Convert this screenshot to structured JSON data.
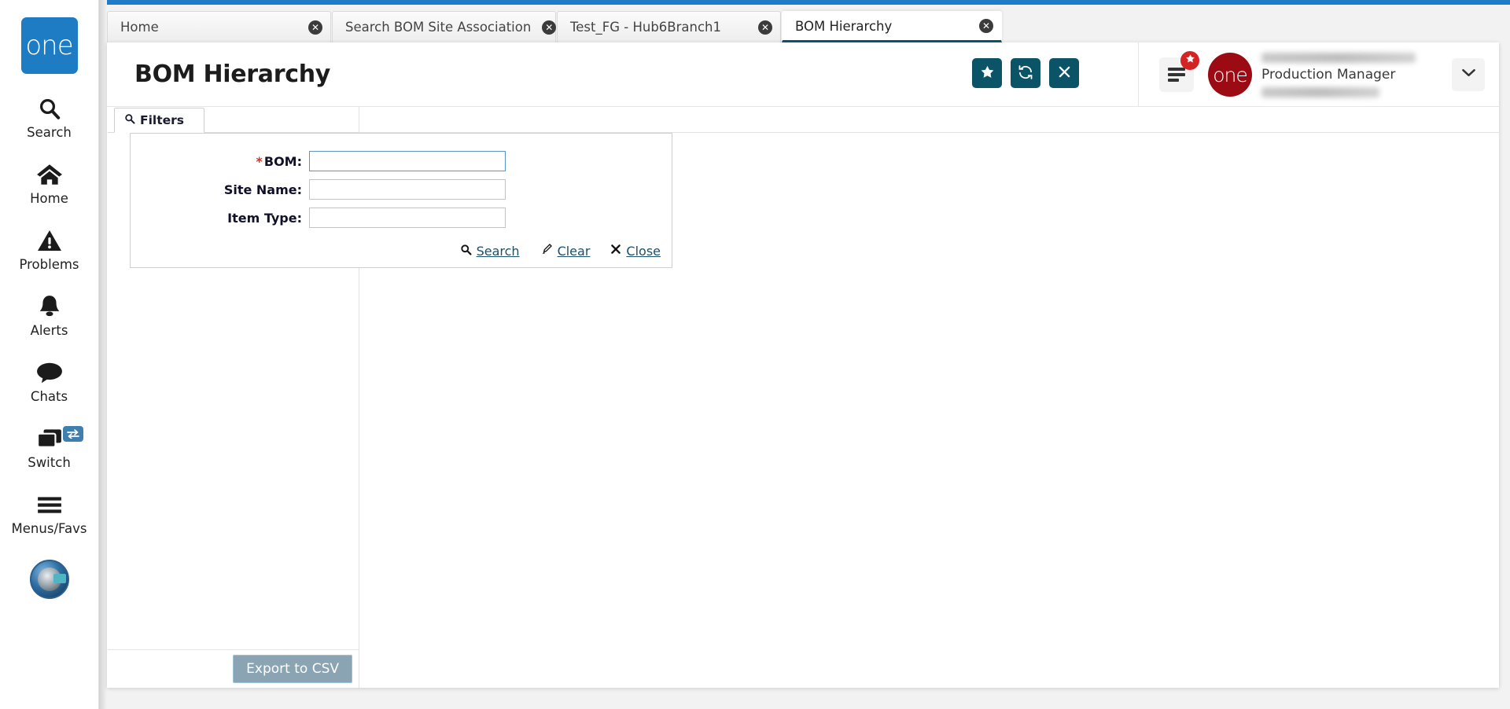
{
  "app": {
    "brand_logo_text": "one",
    "accent_blue": "#1f7bc8",
    "accent_teal": "#0b5366",
    "accent_red": "#9c0a14"
  },
  "sidebar": {
    "items": [
      {
        "label": "Search",
        "icon": "search-icon"
      },
      {
        "label": "Home",
        "icon": "home-icon"
      },
      {
        "label": "Problems",
        "icon": "warning-triangle-icon"
      },
      {
        "label": "Alerts",
        "icon": "bell-icon"
      },
      {
        "label": "Chats",
        "icon": "chat-bubble-icon"
      },
      {
        "label": "Switch",
        "icon": "switch-windows-icon",
        "badge_icon": "exchange-arrows-icon"
      },
      {
        "label": "Menus/Favs",
        "icon": "hamburger-icon"
      }
    ],
    "avatar_icon": "user-avatar-icon"
  },
  "tabs": [
    {
      "label": "Home",
      "active": false,
      "close_icon": "close-circle-icon"
    },
    {
      "label": "Search BOM Site Association",
      "active": false,
      "close_icon": "close-circle-icon"
    },
    {
      "label": "Test_FG - Hub6Branch1",
      "active": false,
      "close_icon": "close-circle-icon"
    },
    {
      "label": "BOM Hierarchy",
      "active": true,
      "close_icon": "close-circle-icon"
    }
  ],
  "header": {
    "title": "BOM Hierarchy",
    "actions": [
      {
        "name": "favorite-button",
        "icon": "star-icon"
      },
      {
        "name": "refresh-button",
        "icon": "refresh-icon"
      },
      {
        "name": "close-page-button",
        "icon": "x-icon"
      }
    ],
    "menu_button": {
      "icon": "hamburger-icon",
      "badge_icon": "star-icon"
    },
    "user": {
      "badge_text": "one",
      "name_redacted": true,
      "role": "Production Manager",
      "org_redacted": true,
      "caret_icon": "chevron-down-icon"
    }
  },
  "left_panel": {
    "tab": {
      "label": "Filters",
      "icon": "search-icon"
    },
    "export_button": "Export to CSV"
  },
  "filters": {
    "fields": [
      {
        "label": "BOM:",
        "required": true,
        "value": "",
        "placeholder": "",
        "focused": true
      },
      {
        "label": "Site Name:",
        "required": false,
        "value": "",
        "placeholder": "",
        "focused": false
      },
      {
        "label": "Item Type:",
        "required": false,
        "value": "",
        "placeholder": "",
        "focused": false
      }
    ],
    "actions": [
      {
        "label": "Search",
        "icon": "search-icon"
      },
      {
        "label": "Clear",
        "icon": "eraser-icon"
      },
      {
        "label": "Close",
        "icon": "x-icon"
      }
    ]
  }
}
